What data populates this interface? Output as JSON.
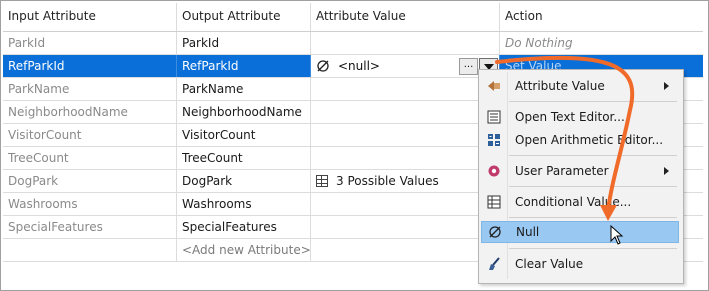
{
  "columns": [
    "Input Attribute",
    "Output Attribute",
    "Attribute Value",
    "Action"
  ],
  "rows": [
    {
      "input": "ParkId",
      "output": "ParkId",
      "value": "",
      "action": "Do Nothing"
    },
    {
      "input": "RefParkId",
      "output": "RefParkId",
      "value": "<null>",
      "action": "Set Value"
    },
    {
      "input": "ParkName",
      "output": "ParkName",
      "value": "",
      "action": ""
    },
    {
      "input": "NeighborhoodName",
      "output": "NeighborhoodName",
      "value": "",
      "action": ""
    },
    {
      "input": "VisitorCount",
      "output": "VisitorCount",
      "value": "",
      "action": ""
    },
    {
      "input": "TreeCount",
      "output": "TreeCount",
      "value": "",
      "action": ""
    },
    {
      "input": "DogPark",
      "output": "DogPark",
      "value": "3 Possible Values",
      "action": ""
    },
    {
      "input": "Washrooms",
      "output": "Washrooms",
      "value": "",
      "action": ""
    },
    {
      "input": "SpecialFeatures",
      "output": "SpecialFeatures",
      "value": "",
      "action": ""
    }
  ],
  "add_new": "<Add new Attribute>",
  "dots_button": "...",
  "menu": {
    "attribute_value": "Attribute Value",
    "open_text_editor": "Open Text Editor...",
    "open_arithmetic_editor": "Open Arithmetic Editor...",
    "user_parameter": "User Parameter",
    "conditional_value": "Conditional Value...",
    "null": "Null",
    "clear_value": "Clear Value"
  },
  "colors": {
    "selection": "#0a6fd8",
    "menu_highlight": "#99c9f3",
    "annotation_arrow": "#f06b2a"
  },
  "icons": [
    "null-icon",
    "table-icon",
    "attribute-value-icon",
    "text-editor-icon",
    "arithmetic-editor-icon",
    "user-parameter-icon",
    "conditional-value-icon",
    "clear-value-icon",
    "dropdown-arrow-icon",
    "submenu-arrow-icon",
    "mouse-cursor-icon"
  ]
}
